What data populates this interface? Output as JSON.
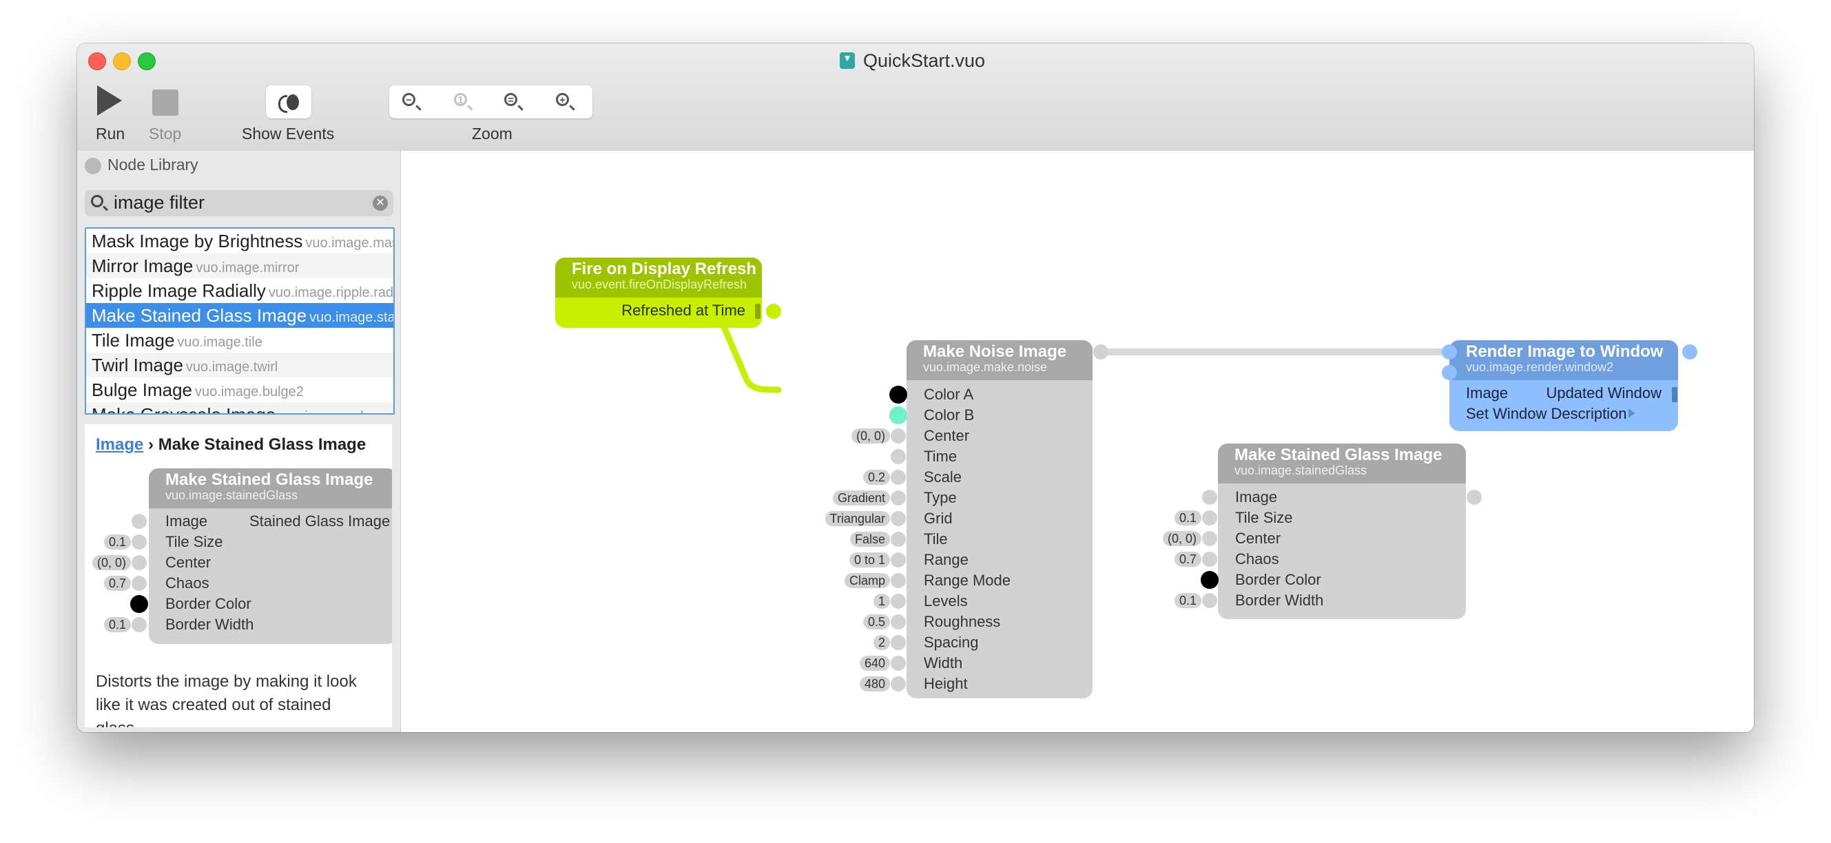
{
  "window": {
    "title": "QuickStart.vuo"
  },
  "toolbar": {
    "run_label": "Run",
    "stop_label": "Stop",
    "events_label": "Show Events",
    "zoom_label": "Zoom"
  },
  "sidebar": {
    "library_label": "Node Library",
    "search_value": "image filter",
    "items": [
      {
        "title": "Mask Image by Brightness",
        "cls": "vuo.image.mask.brightness"
      },
      {
        "title": "Mirror Image",
        "cls": "vuo.image.mirror"
      },
      {
        "title": "Ripple Image Radially",
        "cls": "vuo.image.ripple.radial"
      },
      {
        "title": "Make Stained Glass Image",
        "cls": "vuo.image.stainedGlass",
        "selected": true
      },
      {
        "title": "Tile Image",
        "cls": "vuo.image.tile"
      },
      {
        "title": "Twirl Image",
        "cls": "vuo.image.twirl"
      },
      {
        "title": "Bulge Image",
        "cls": "vuo.image.bulge2"
      },
      {
        "title": "Make Grayscale Image",
        "cls": "vuo.image.color.grayscale"
      }
    ],
    "doc": {
      "crumb_link": "Image",
      "crumb_sep": "›",
      "crumb_title": "Make Stained Glass Image",
      "description": "Distorts the image by making it look like it was created out of stained glass."
    }
  },
  "nodes": {
    "doc_preview": {
      "title": "Make Stained Glass Image",
      "cls": "vuo.image.stainedGlass",
      "inputs": [
        "Image",
        "Tile Size",
        "Center",
        "Chaos",
        "Border Color",
        "Border Width"
      ],
      "values": [
        "",
        "0.1",
        "(0, 0)",
        "0.7",
        "",
        "0.1"
      ],
      "output": "Stained Glass Image",
      "border_color": "#000000"
    },
    "fire": {
      "title": "Fire on Display Refresh",
      "cls": "vuo.event.fireOnDisplayRefresh",
      "output": "Refreshed at Time",
      "color": "#9cc400"
    },
    "noise": {
      "title": "Make Noise Image",
      "cls": "vuo.image.make.noise",
      "inputs": [
        "Color A",
        "Color B",
        "Center",
        "Time",
        "Scale",
        "Type",
        "Grid",
        "Tile",
        "Range",
        "Range Mode",
        "Levels",
        "Roughness",
        "Spacing",
        "Width",
        "Height"
      ],
      "values": [
        "",
        "",
        "(0, 0)",
        "",
        "0.2",
        "Gradient",
        "Triangular",
        "False",
        "0 to 1",
        "Clamp",
        "1",
        "0.5",
        "2",
        "640",
        "480"
      ],
      "color_a": "#000000",
      "color_b": "#6ef2c8"
    },
    "stained": {
      "title": "Make Stained Glass Image",
      "cls": "vuo.image.stainedGlass",
      "inputs": [
        "Image",
        "Tile Size",
        "Center",
        "Chaos",
        "Border Color",
        "Border Width"
      ],
      "values": [
        "",
        "0.1",
        "(0, 0)",
        "0.7",
        "",
        "0.1"
      ],
      "border_color": "#000000"
    },
    "render": {
      "title": "Render Image to Window",
      "cls": "vuo.image.render.window2",
      "inputs": [
        "Image",
        "Set Window Description"
      ],
      "output": "Updated Window",
      "color": "#6f9fdf"
    }
  }
}
